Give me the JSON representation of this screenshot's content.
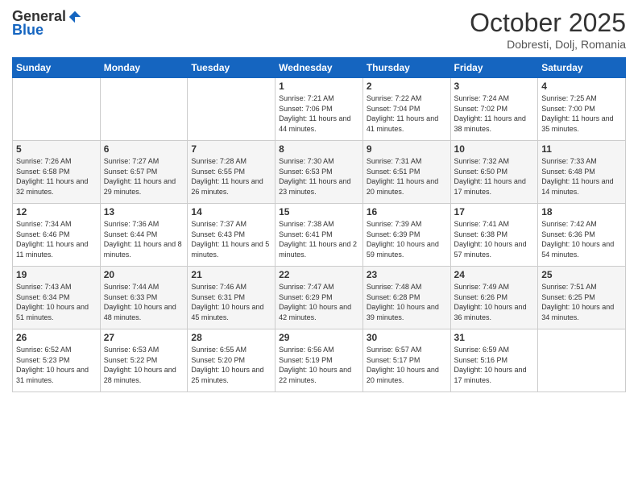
{
  "logo": {
    "general": "General",
    "blue": "Blue"
  },
  "header": {
    "month": "October 2025",
    "location": "Dobresti, Dolj, Romania"
  },
  "weekdays": [
    "Sunday",
    "Monday",
    "Tuesday",
    "Wednesday",
    "Thursday",
    "Friday",
    "Saturday"
  ],
  "weeks": [
    [
      {
        "day": "",
        "sunrise": "",
        "sunset": "",
        "daylight": ""
      },
      {
        "day": "",
        "sunrise": "",
        "sunset": "",
        "daylight": ""
      },
      {
        "day": "",
        "sunrise": "",
        "sunset": "",
        "daylight": ""
      },
      {
        "day": "1",
        "sunrise": "Sunrise: 7:21 AM",
        "sunset": "Sunset: 7:06 PM",
        "daylight": "Daylight: 11 hours and 44 minutes."
      },
      {
        "day": "2",
        "sunrise": "Sunrise: 7:22 AM",
        "sunset": "Sunset: 7:04 PM",
        "daylight": "Daylight: 11 hours and 41 minutes."
      },
      {
        "day": "3",
        "sunrise": "Sunrise: 7:24 AM",
        "sunset": "Sunset: 7:02 PM",
        "daylight": "Daylight: 11 hours and 38 minutes."
      },
      {
        "day": "4",
        "sunrise": "Sunrise: 7:25 AM",
        "sunset": "Sunset: 7:00 PM",
        "daylight": "Daylight: 11 hours and 35 minutes."
      }
    ],
    [
      {
        "day": "5",
        "sunrise": "Sunrise: 7:26 AM",
        "sunset": "Sunset: 6:58 PM",
        "daylight": "Daylight: 11 hours and 32 minutes."
      },
      {
        "day": "6",
        "sunrise": "Sunrise: 7:27 AM",
        "sunset": "Sunset: 6:57 PM",
        "daylight": "Daylight: 11 hours and 29 minutes."
      },
      {
        "day": "7",
        "sunrise": "Sunrise: 7:28 AM",
        "sunset": "Sunset: 6:55 PM",
        "daylight": "Daylight: 11 hours and 26 minutes."
      },
      {
        "day": "8",
        "sunrise": "Sunrise: 7:30 AM",
        "sunset": "Sunset: 6:53 PM",
        "daylight": "Daylight: 11 hours and 23 minutes."
      },
      {
        "day": "9",
        "sunrise": "Sunrise: 7:31 AM",
        "sunset": "Sunset: 6:51 PM",
        "daylight": "Daylight: 11 hours and 20 minutes."
      },
      {
        "day": "10",
        "sunrise": "Sunrise: 7:32 AM",
        "sunset": "Sunset: 6:50 PM",
        "daylight": "Daylight: 11 hours and 17 minutes."
      },
      {
        "day": "11",
        "sunrise": "Sunrise: 7:33 AM",
        "sunset": "Sunset: 6:48 PM",
        "daylight": "Daylight: 11 hours and 14 minutes."
      }
    ],
    [
      {
        "day": "12",
        "sunrise": "Sunrise: 7:34 AM",
        "sunset": "Sunset: 6:46 PM",
        "daylight": "Daylight: 11 hours and 11 minutes."
      },
      {
        "day": "13",
        "sunrise": "Sunrise: 7:36 AM",
        "sunset": "Sunset: 6:44 PM",
        "daylight": "Daylight: 11 hours and 8 minutes."
      },
      {
        "day": "14",
        "sunrise": "Sunrise: 7:37 AM",
        "sunset": "Sunset: 6:43 PM",
        "daylight": "Daylight: 11 hours and 5 minutes."
      },
      {
        "day": "15",
        "sunrise": "Sunrise: 7:38 AM",
        "sunset": "Sunset: 6:41 PM",
        "daylight": "Daylight: 11 hours and 2 minutes."
      },
      {
        "day": "16",
        "sunrise": "Sunrise: 7:39 AM",
        "sunset": "Sunset: 6:39 PM",
        "daylight": "Daylight: 10 hours and 59 minutes."
      },
      {
        "day": "17",
        "sunrise": "Sunrise: 7:41 AM",
        "sunset": "Sunset: 6:38 PM",
        "daylight": "Daylight: 10 hours and 57 minutes."
      },
      {
        "day": "18",
        "sunrise": "Sunrise: 7:42 AM",
        "sunset": "Sunset: 6:36 PM",
        "daylight": "Daylight: 10 hours and 54 minutes."
      }
    ],
    [
      {
        "day": "19",
        "sunrise": "Sunrise: 7:43 AM",
        "sunset": "Sunset: 6:34 PM",
        "daylight": "Daylight: 10 hours and 51 minutes."
      },
      {
        "day": "20",
        "sunrise": "Sunrise: 7:44 AM",
        "sunset": "Sunset: 6:33 PM",
        "daylight": "Daylight: 10 hours and 48 minutes."
      },
      {
        "day": "21",
        "sunrise": "Sunrise: 7:46 AM",
        "sunset": "Sunset: 6:31 PM",
        "daylight": "Daylight: 10 hours and 45 minutes."
      },
      {
        "day": "22",
        "sunrise": "Sunrise: 7:47 AM",
        "sunset": "Sunset: 6:29 PM",
        "daylight": "Daylight: 10 hours and 42 minutes."
      },
      {
        "day": "23",
        "sunrise": "Sunrise: 7:48 AM",
        "sunset": "Sunset: 6:28 PM",
        "daylight": "Daylight: 10 hours and 39 minutes."
      },
      {
        "day": "24",
        "sunrise": "Sunrise: 7:49 AM",
        "sunset": "Sunset: 6:26 PM",
        "daylight": "Daylight: 10 hours and 36 minutes."
      },
      {
        "day": "25",
        "sunrise": "Sunrise: 7:51 AM",
        "sunset": "Sunset: 6:25 PM",
        "daylight": "Daylight: 10 hours and 34 minutes."
      }
    ],
    [
      {
        "day": "26",
        "sunrise": "Sunrise: 6:52 AM",
        "sunset": "Sunset: 5:23 PM",
        "daylight": "Daylight: 10 hours and 31 minutes."
      },
      {
        "day": "27",
        "sunrise": "Sunrise: 6:53 AM",
        "sunset": "Sunset: 5:22 PM",
        "daylight": "Daylight: 10 hours and 28 minutes."
      },
      {
        "day": "28",
        "sunrise": "Sunrise: 6:55 AM",
        "sunset": "Sunset: 5:20 PM",
        "daylight": "Daylight: 10 hours and 25 minutes."
      },
      {
        "day": "29",
        "sunrise": "Sunrise: 6:56 AM",
        "sunset": "Sunset: 5:19 PM",
        "daylight": "Daylight: 10 hours and 22 minutes."
      },
      {
        "day": "30",
        "sunrise": "Sunrise: 6:57 AM",
        "sunset": "Sunset: 5:17 PM",
        "daylight": "Daylight: 10 hours and 20 minutes."
      },
      {
        "day": "31",
        "sunrise": "Sunrise: 6:59 AM",
        "sunset": "Sunset: 5:16 PM",
        "daylight": "Daylight: 10 hours and 17 minutes."
      },
      {
        "day": "",
        "sunrise": "",
        "sunset": "",
        "daylight": ""
      }
    ]
  ]
}
